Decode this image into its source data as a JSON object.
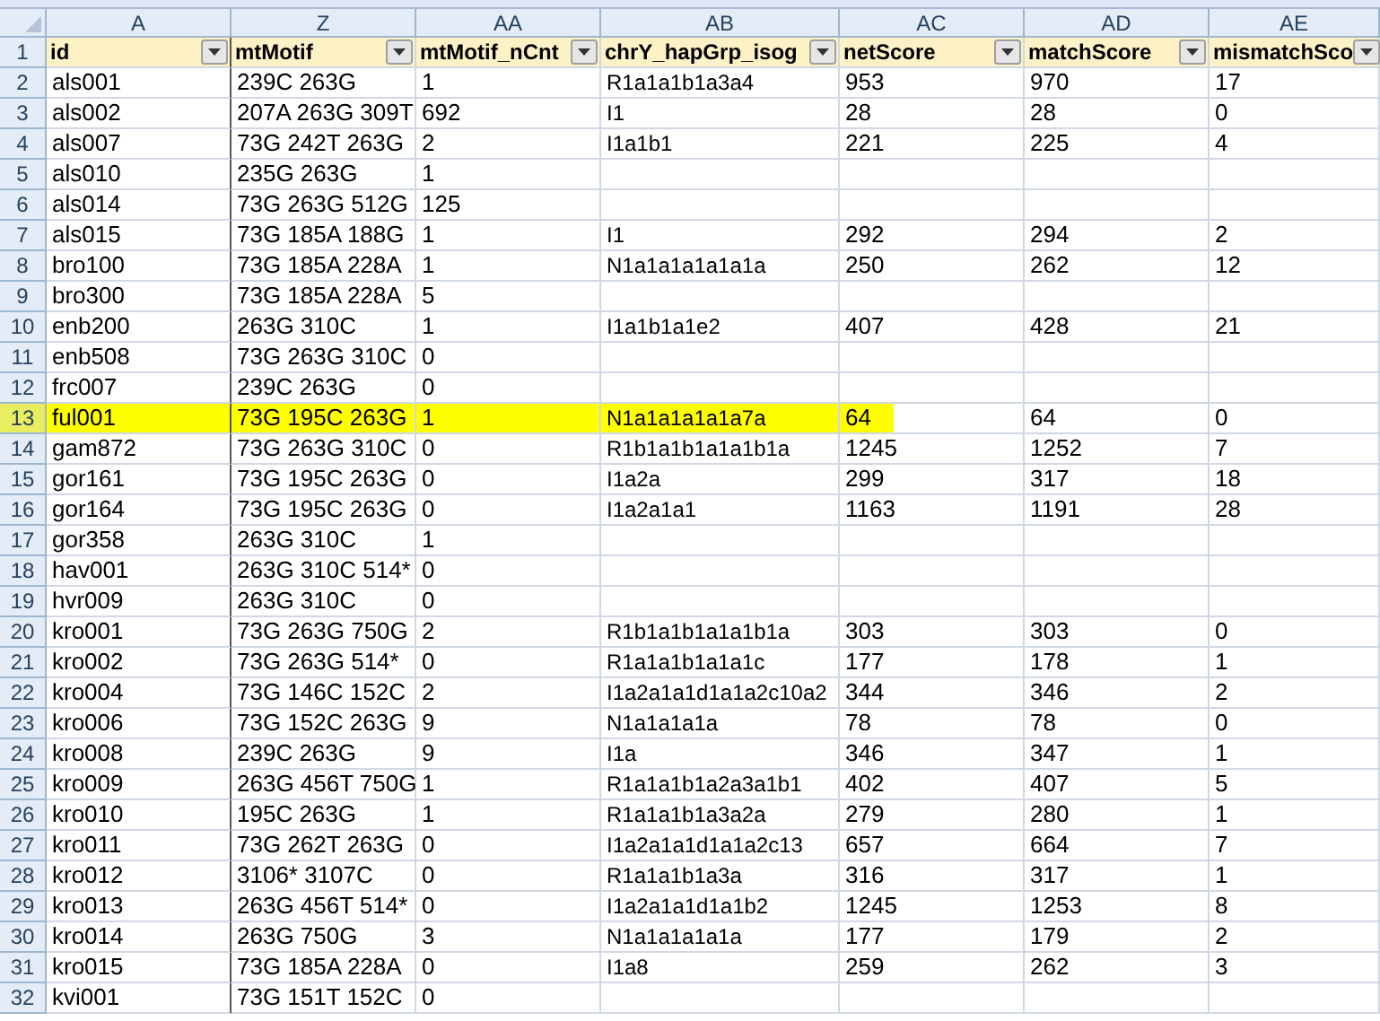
{
  "column_letters": [
    "A",
    "Z",
    "AA",
    "AB",
    "AC",
    "AD",
    "AE"
  ],
  "header_row": {
    "number": "1",
    "cells": [
      "id",
      "mtMotif",
      "mtMotif_nCnt",
      "chrY_hapGrp_isog",
      "netScore",
      "matchScore",
      "mismatchSco"
    ]
  },
  "rows": [
    {
      "number": "2",
      "highlighted": false,
      "cells": [
        "als001",
        "239C 263G",
        "1",
        "R1a1a1b1a3a4",
        "953",
        "970",
        "17"
      ]
    },
    {
      "number": "3",
      "highlighted": false,
      "cells": [
        "als002",
        "207A 263G 309T",
        "692",
        "I1",
        "28",
        "28",
        "0"
      ]
    },
    {
      "number": "4",
      "highlighted": false,
      "cells": [
        "als007",
        "73G 242T 263G",
        "2",
        "I1a1b1",
        "221",
        "225",
        "4"
      ]
    },
    {
      "number": "5",
      "highlighted": false,
      "cells": [
        "als010",
        "235G 263G",
        "1",
        "",
        "",
        "",
        ""
      ]
    },
    {
      "number": "6",
      "highlighted": false,
      "cells": [
        "als014",
        "73G 263G 512G",
        "125",
        "",
        "",
        "",
        ""
      ]
    },
    {
      "number": "7",
      "highlighted": false,
      "cells": [
        "als015",
        "73G 185A 188G",
        "1",
        "I1",
        "292",
        "294",
        "2"
      ]
    },
    {
      "number": "8",
      "highlighted": false,
      "cells": [
        "bro100",
        "73G 185A 228A",
        "1",
        "N1a1a1a1a1a1a",
        "250",
        "262",
        "12"
      ]
    },
    {
      "number": "9",
      "highlighted": false,
      "cells": [
        "bro300",
        "73G 185A 228A",
        "5",
        "",
        "",
        "",
        ""
      ]
    },
    {
      "number": "10",
      "highlighted": false,
      "cells": [
        "enb200",
        "263G 310C",
        "1",
        "I1a1b1a1e2",
        "407",
        "428",
        "21"
      ]
    },
    {
      "number": "11",
      "highlighted": false,
      "cells": [
        "enb508",
        "73G 263G 310C",
        "0",
        "",
        "",
        "",
        ""
      ]
    },
    {
      "number": "12",
      "highlighted": false,
      "cells": [
        "frc007",
        "239C 263G",
        "0",
        "",
        "",
        "",
        ""
      ]
    },
    {
      "number": "13",
      "highlighted": true,
      "cells": [
        "ful001",
        "73G 195C 263G",
        "1",
        "N1a1a1a1a1a7a",
        "64",
        "64",
        "0"
      ]
    },
    {
      "number": "14",
      "highlighted": false,
      "cells": [
        "gam872",
        "73G 263G 310C",
        "0",
        "R1b1a1b1a1a1b1a",
        "1245",
        "1252",
        "7"
      ]
    },
    {
      "number": "15",
      "highlighted": false,
      "cells": [
        "gor161",
        "73G 195C 263G",
        "0",
        "I1a2a",
        "299",
        "317",
        "18"
      ]
    },
    {
      "number": "16",
      "highlighted": false,
      "cells": [
        "gor164",
        "73G 195C 263G",
        "0",
        "I1a2a1a1",
        "1163",
        "1191",
        "28"
      ]
    },
    {
      "number": "17",
      "highlighted": false,
      "cells": [
        "gor358",
        "263G 310C",
        "1",
        "",
        "",
        "",
        ""
      ]
    },
    {
      "number": "18",
      "highlighted": false,
      "cells": [
        "hav001",
        "263G 310C 514*",
        "0",
        "",
        "",
        "",
        ""
      ]
    },
    {
      "number": "19",
      "highlighted": false,
      "cells": [
        "hvr009",
        "263G 310C",
        "0",
        "",
        "",
        "",
        ""
      ]
    },
    {
      "number": "20",
      "highlighted": false,
      "cells": [
        "kro001",
        "73G 263G 750G",
        "2",
        "R1b1a1b1a1a1b1a",
        "303",
        "303",
        "0"
      ]
    },
    {
      "number": "21",
      "highlighted": false,
      "cells": [
        "kro002",
        "73G 263G 514*",
        "0",
        "R1a1a1b1a1a1c",
        "177",
        "178",
        "1"
      ]
    },
    {
      "number": "22",
      "highlighted": false,
      "cells": [
        "kro004",
        "73G 146C 152C",
        "2",
        "I1a2a1a1d1a1a2c10a2",
        "344",
        "346",
        "2"
      ]
    },
    {
      "number": "23",
      "highlighted": false,
      "cells": [
        "kro006",
        "73G 152C 263G",
        "9",
        "N1a1a1a1a",
        "78",
        "78",
        "0"
      ]
    },
    {
      "number": "24",
      "highlighted": false,
      "cells": [
        "kro008",
        "239C 263G",
        "9",
        "I1a",
        "346",
        "347",
        "1"
      ]
    },
    {
      "number": "25",
      "highlighted": false,
      "cells": [
        "kro009",
        "263G 456T 750G",
        "1",
        "R1a1a1b1a2a3a1b1",
        "402",
        "407",
        "5"
      ]
    },
    {
      "number": "26",
      "highlighted": false,
      "cells": [
        "kro010",
        "195C 263G",
        "1",
        "R1a1a1b1a3a2a",
        "279",
        "280",
        "1"
      ]
    },
    {
      "number": "27",
      "highlighted": false,
      "cells": [
        "kro011",
        "73G 262T 263G",
        "0",
        "I1a2a1a1d1a1a2c13",
        "657",
        "664",
        "7"
      ]
    },
    {
      "number": "28",
      "highlighted": false,
      "cells": [
        "kro012",
        "3106* 3107C",
        "0",
        "R1a1a1b1a3a",
        "316",
        "317",
        "1"
      ]
    },
    {
      "number": "29",
      "highlighted": false,
      "cells": [
        "kro013",
        "263G 456T 514*",
        "0",
        "I1a2a1a1d1a1b2",
        "1245",
        "1253",
        "8"
      ]
    },
    {
      "number": "30",
      "highlighted": false,
      "cells": [
        "kro014",
        "263G 750G",
        "3",
        "N1a1a1a1a1a",
        "177",
        "179",
        "2"
      ]
    },
    {
      "number": "31",
      "highlighted": false,
      "cells": [
        "kro015",
        "73G 185A 228A",
        "0",
        "I1a8",
        "259",
        "262",
        "3"
      ]
    },
    {
      "number": "32",
      "highlighted": false,
      "cells": [
        "kvi001",
        "73G 151T 152C",
        "0",
        "",
        "",
        "",
        ""
      ]
    }
  ]
}
